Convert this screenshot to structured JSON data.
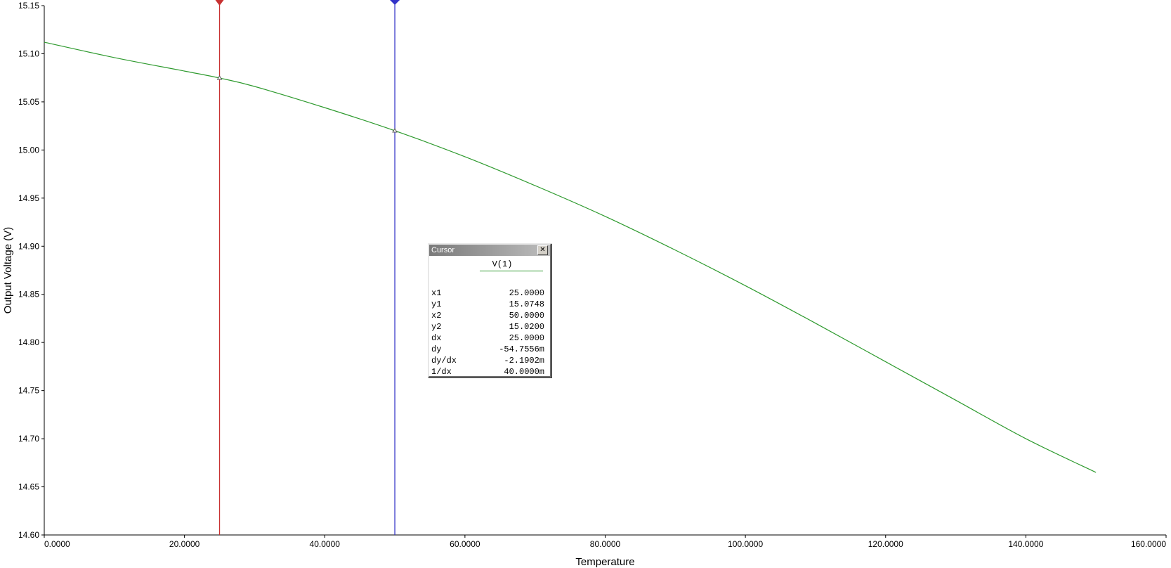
{
  "chart_data": {
    "type": "line",
    "title": "",
    "xlabel": "Temperature",
    "ylabel": "Output Voltage (V)",
    "xlim": [
      0,
      160
    ],
    "ylim": [
      14.6,
      15.15
    ],
    "x_tick_labels": [
      "0.0000",
      "20.0000",
      "40.0000",
      "60.0000",
      "80.0000",
      "100.0000",
      "120.0000",
      "140.0000",
      "160.0000"
    ],
    "x_ticks": [
      0,
      20,
      40,
      60,
      80,
      100,
      120,
      140,
      160
    ],
    "y_tick_labels": [
      "14.60",
      "14.65",
      "14.70",
      "14.75",
      "14.80",
      "14.85",
      "14.90",
      "14.95",
      "15.00",
      "15.05",
      "15.10",
      "15.15"
    ],
    "y_ticks": [
      14.6,
      14.65,
      14.7,
      14.75,
      14.8,
      14.85,
      14.9,
      14.95,
      15.0,
      15.05,
      15.1,
      15.15
    ],
    "grid": false,
    "series": [
      {
        "name": "V(1)",
        "color": "#2e9a2e",
        "x": [
          0,
          10,
          20,
          25,
          30,
          40,
          50,
          60,
          70,
          80,
          90,
          100,
          110,
          120,
          130,
          140,
          150
        ],
        "y": [
          15.112,
          15.096,
          15.082,
          15.0748,
          15.066,
          15.044,
          15.02,
          14.993,
          14.963,
          14.931,
          14.896,
          14.859,
          14.82,
          14.78,
          14.74,
          14.7,
          14.665
        ]
      }
    ],
    "cursors": [
      {
        "id": "1",
        "x": 25.0,
        "color": "#c83232"
      },
      {
        "id": "2",
        "x": 50.0,
        "color": "#3232c8"
      }
    ]
  },
  "cursor_window": {
    "title": "Cursor",
    "close_glyph": "✕",
    "series_name": "V(1)",
    "rows": [
      {
        "label": "x1",
        "value": "25.0000"
      },
      {
        "label": "y1",
        "value": "15.0748"
      },
      {
        "label": "x2",
        "value": "50.0000"
      },
      {
        "label": "y2",
        "value": "15.0200"
      },
      {
        "label": "dx",
        "value": "25.0000"
      },
      {
        "label": "dy",
        "value": "-54.7556m"
      },
      {
        "label": "dy/dx",
        "value": "-2.1902m"
      },
      {
        "label": "1/dx",
        "value": "40.0000m"
      }
    ]
  }
}
